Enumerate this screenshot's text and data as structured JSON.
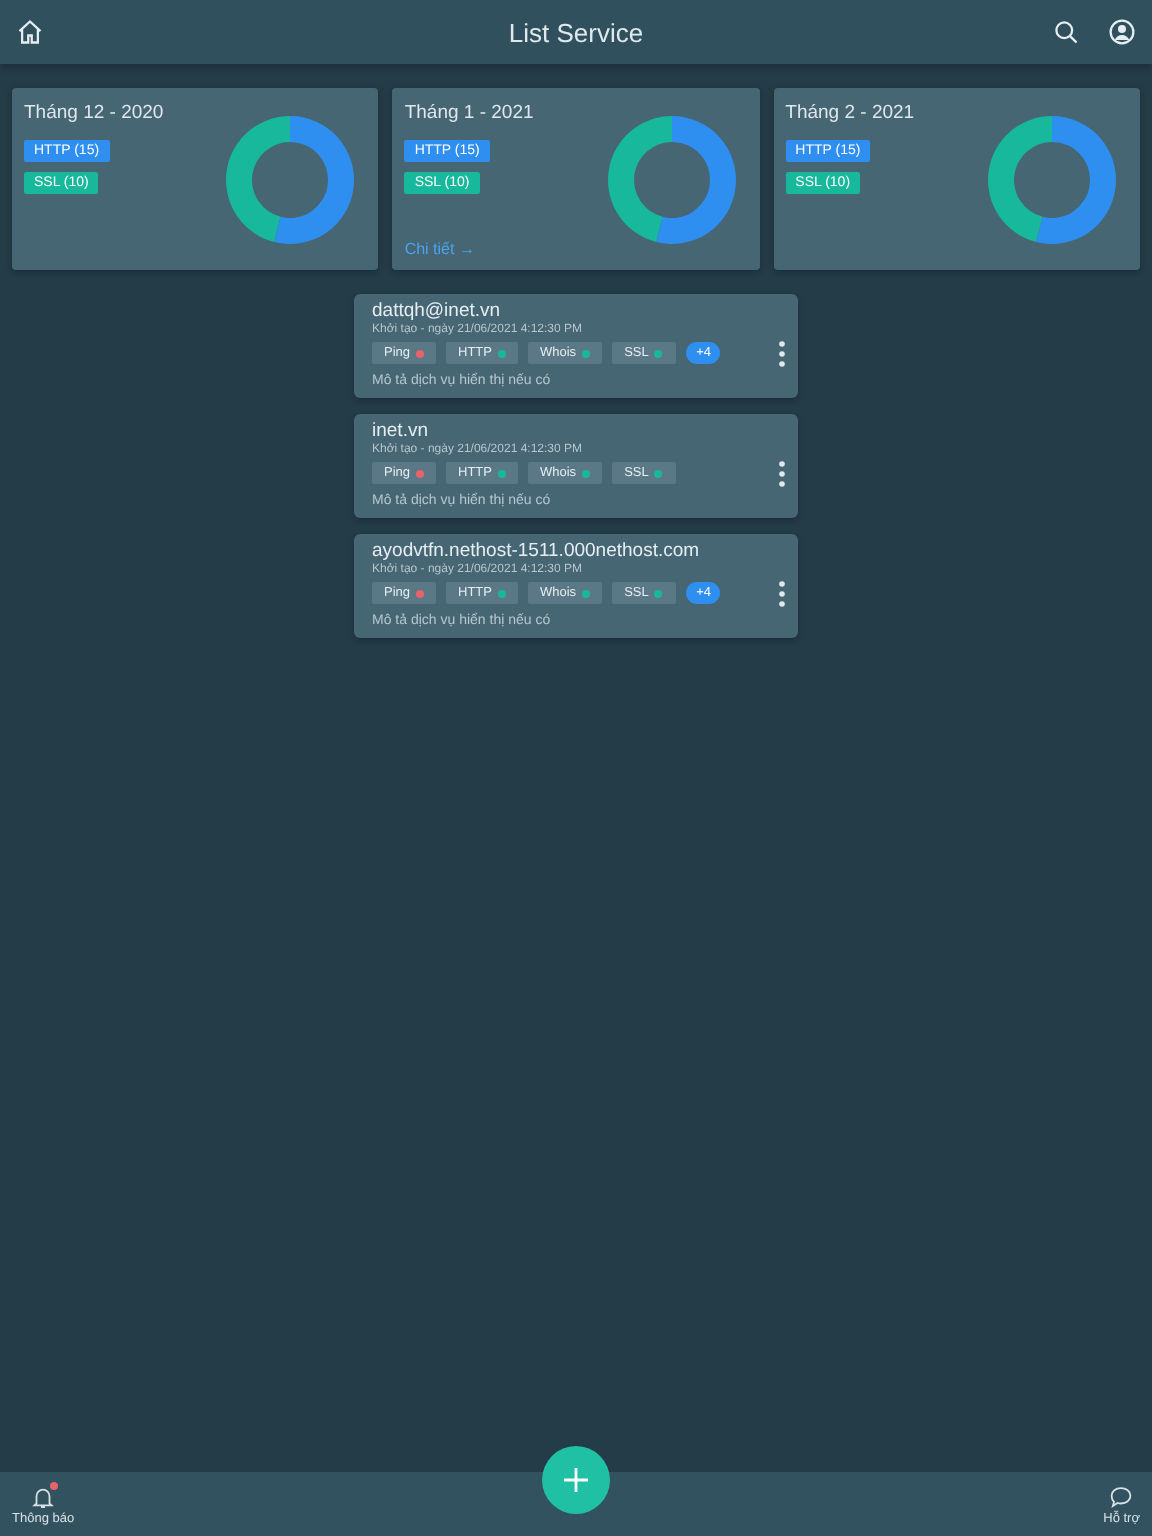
{
  "header": {
    "title": "List Service"
  },
  "stats": [
    {
      "title": "Tháng 12 - 2020",
      "legend": [
        {
          "label": "HTTP (15)",
          "color": "#2f8ff0"
        },
        {
          "label": "SSL (10)",
          "color": "#17b89b"
        }
      ]
    },
    {
      "title": "Tháng 1 - 2021",
      "legend": [
        {
          "label": "HTTP (15)",
          "color": "#2f8ff0"
        },
        {
          "label": "SSL (10)",
          "color": "#17b89b"
        }
      ],
      "link": "Chi tiết →"
    },
    {
      "title": "Tháng 2 - 2021",
      "legend": [
        {
          "label": "HTTP (15)",
          "color": "#2f8ff0"
        },
        {
          "label": "SSL (10)",
          "color": "#17b89b"
        }
      ]
    }
  ],
  "services": [
    {
      "name": "dattqh@inet.vn",
      "created": "Khởi tạo - ngày 21/06/2021 4:12:30 PM",
      "tags": [
        {
          "label": "Ping",
          "color": "#e8646a"
        },
        {
          "label": "HTTP",
          "color": "#17b89b"
        },
        {
          "label": "Whois",
          "color": "#17b89b"
        },
        {
          "label": "SSL",
          "color": "#17b89b"
        }
      ],
      "more": "+4",
      "description": "Mô tả dịch vụ hiển thị nếu có"
    },
    {
      "name": "inet.vn",
      "created": "Khởi tạo - ngày 21/06/2021 4:12:30 PM",
      "tags": [
        {
          "label": "Ping",
          "color": "#e8646a"
        },
        {
          "label": "HTTP",
          "color": "#17b89b"
        },
        {
          "label": "Whois",
          "color": "#17b89b"
        },
        {
          "label": "SSL",
          "color": "#17b89b"
        }
      ],
      "description": "Mô tả dịch vụ hiển thị nếu có"
    },
    {
      "name": "ayodvtfn.nethost-1511.000nethost.com",
      "created": "Khởi tạo - ngày 21/06/2021 4:12:30 PM",
      "tags": [
        {
          "label": "Ping",
          "color": "#e8646a"
        },
        {
          "label": "HTTP",
          "color": "#17b89b"
        },
        {
          "label": "Whois",
          "color": "#17b89b"
        },
        {
          "label": "SSL",
          "color": "#17b89b"
        }
      ],
      "more": "+4",
      "description": "Mô tả dịch vụ hiển thị nếu có"
    }
  ],
  "bottom_bar": {
    "notifications": {
      "label": "Thông báo",
      "unread": true
    },
    "support": {
      "label": "Hỗ trợ"
    }
  }
}
